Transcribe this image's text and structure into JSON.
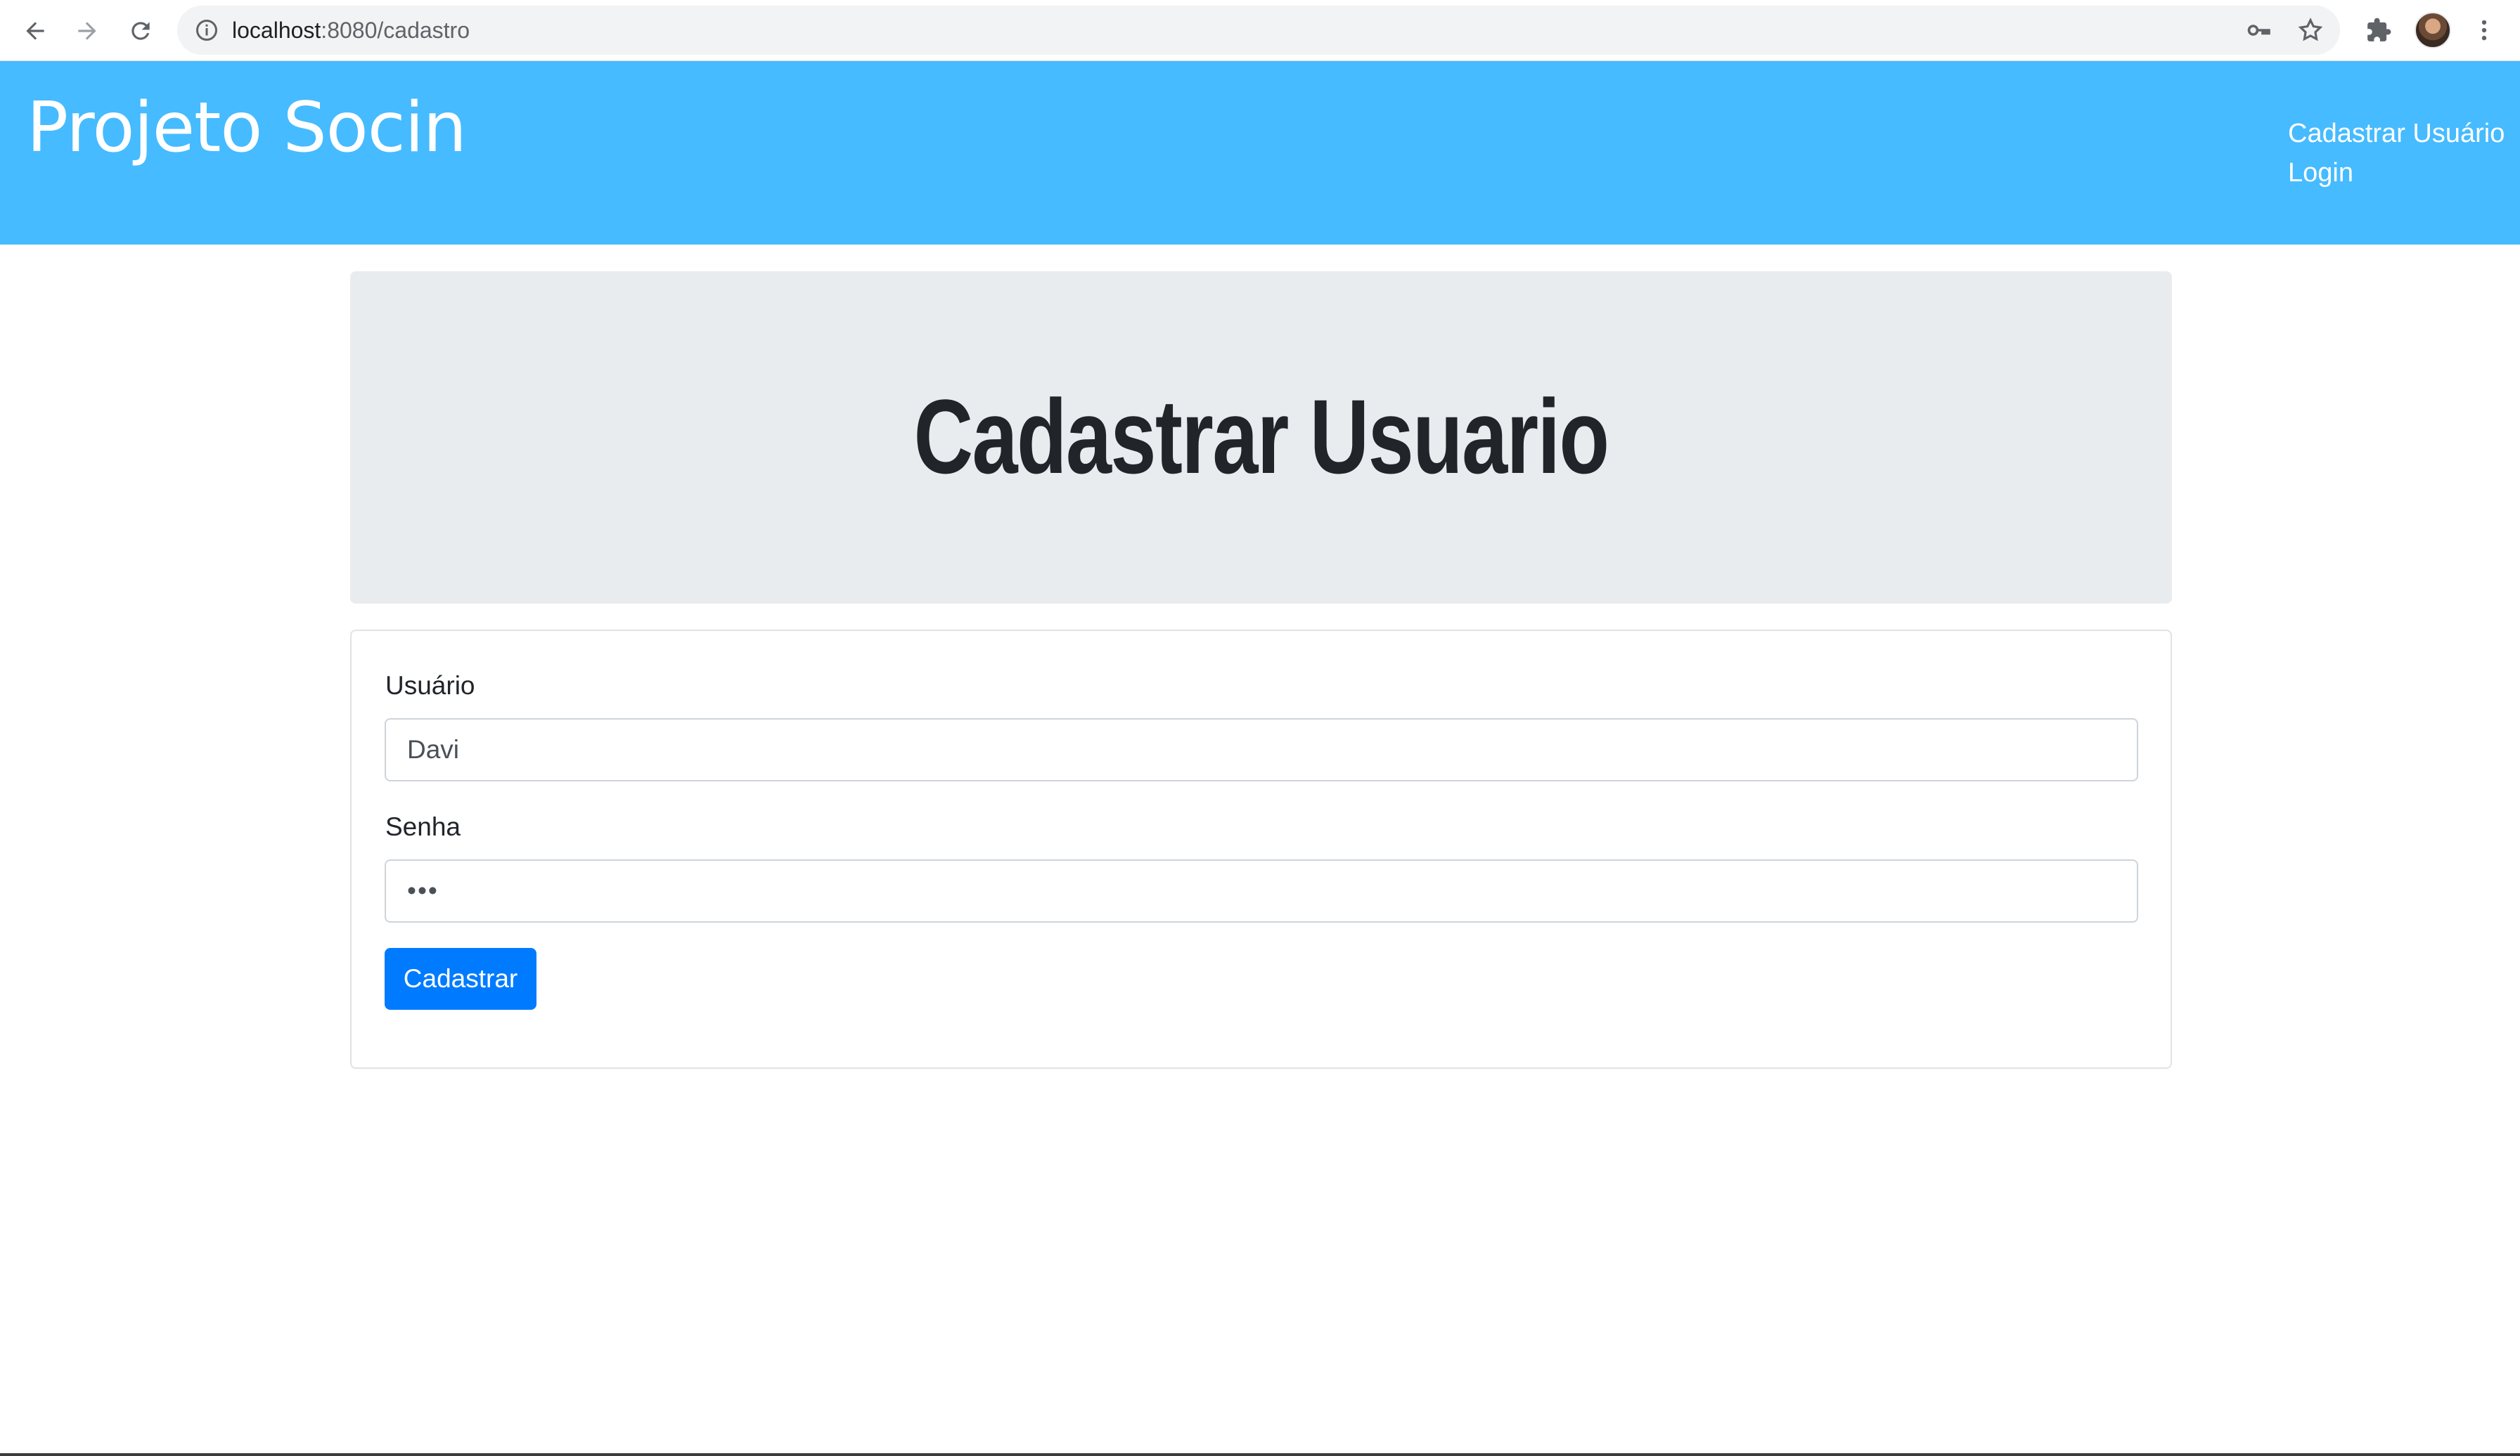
{
  "browser": {
    "url_host": "localhost",
    "url_path": ":8080/cadastro",
    "icons": [
      "back-arrow-icon",
      "forward-arrow-icon",
      "reload-icon",
      "info-icon",
      "key-icon",
      "star-icon",
      "extension-puzzle-icon",
      "profile-avatar",
      "kebab-menu-icon"
    ]
  },
  "navbar": {
    "brand": "Projeto Socin",
    "links": [
      "Cadastrar Usuário",
      "Login"
    ],
    "background": "#46bbff"
  },
  "jumbotron": {
    "title": "Cadastrar Usuario"
  },
  "form": {
    "username_label": "Usuário",
    "username_value": "Davi",
    "password_label": "Senha",
    "password_value": "•••",
    "submit_label": "Cadastrar",
    "button_color": "#007bff"
  }
}
